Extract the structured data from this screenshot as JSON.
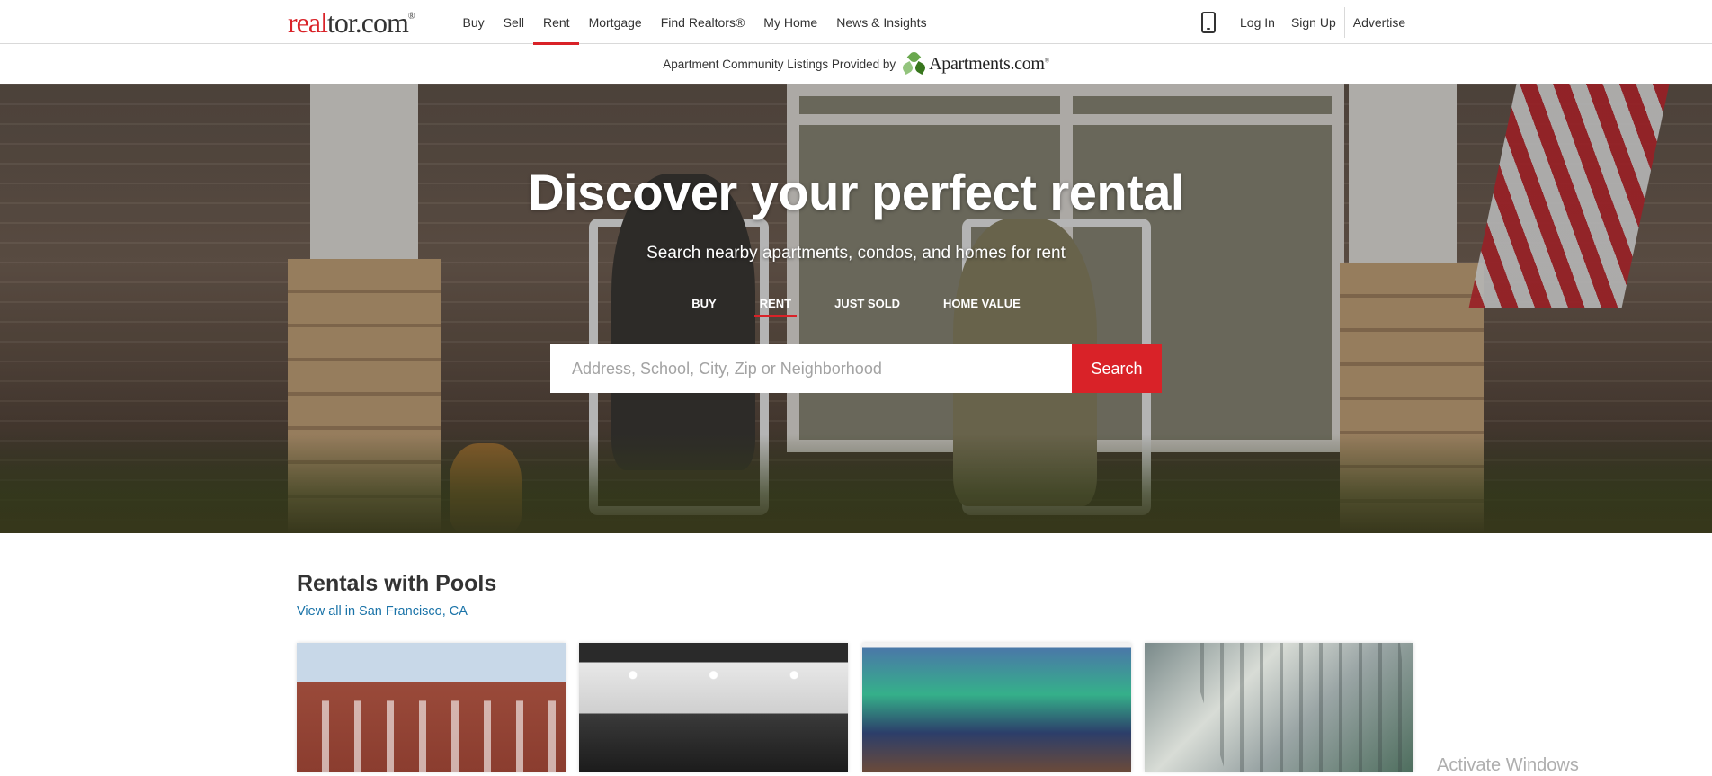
{
  "header": {
    "logo_red": "real",
    "logo_rest": "tor.com",
    "logo_reg": "®",
    "nav": [
      "Buy",
      "Sell",
      "Rent",
      "Mortgage",
      "Find Realtors®",
      "My Home",
      "News & Insights"
    ],
    "active_nav": "Rent",
    "right": {
      "login": "Log In",
      "signup": "Sign Up",
      "advertise": "Advertise"
    }
  },
  "subbanner": {
    "text": "Apartment Community Listings Provided by",
    "partner": "Apartments.com",
    "partner_tm": "®"
  },
  "hero": {
    "title": "Discover your perfect rental",
    "subtitle": "Search nearby apartments, condos, and homes for rent",
    "tabs": [
      "BUY",
      "RENT",
      "JUST SOLD",
      "HOME VALUE"
    ],
    "active_tab": "RENT",
    "search": {
      "placeholder": "Address, School, City, Zip or Neighborhood",
      "value": "",
      "button": "Search"
    }
  },
  "section": {
    "title": "Rentals with Pools",
    "link": "View all in San Francisco, CA"
  },
  "watermark": "Activate Windows",
  "colors": {
    "brand_red": "#d92228",
    "link_blue": "#1a73a8",
    "text_dark": "#333333"
  },
  "icons": [
    "phone-icon",
    "apartments-logo-icon"
  ]
}
